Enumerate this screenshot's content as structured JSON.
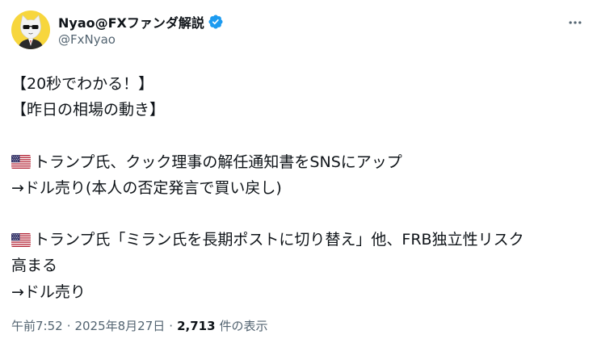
{
  "author": {
    "display_name": "Nyao@FXファンダ解説",
    "handle": "@FxNyao",
    "verified": true
  },
  "more_icon": "more-horizontal-icon",
  "content": {
    "lines": [
      "【20秒でわかる！】",
      "【昨日の相場の動き】",
      "",
      "トランプ氏、クック理事の解任通知書をSNSにアップ",
      "→ドル売り(本人の否定発言で買い戻し)",
      "",
      "トランプ氏「ミラン氏を長期ポストに切り替え」他、FRB独立性リスク",
      "高まる",
      "→ドル売り"
    ],
    "flag_icon": "us-flag-icon"
  },
  "meta": {
    "time": "午前7:52",
    "separator": "·",
    "date": "2025年8月27日",
    "view_count": "2,713",
    "view_label": "件の表示"
  },
  "colors": {
    "text": "#0f1419",
    "secondary": "#536471",
    "verified_badge": "#1d9bf0",
    "avatar_bg": "#f7d63d"
  }
}
